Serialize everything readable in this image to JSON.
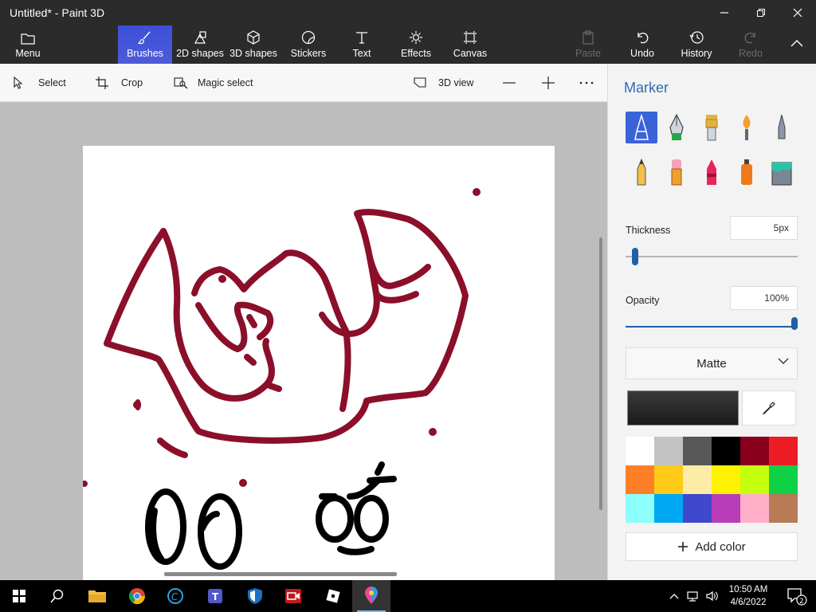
{
  "window": {
    "title": "Untitled* - Paint 3D"
  },
  "ribbon": {
    "menu_label": "Menu",
    "tabs": [
      {
        "label": "Brushes",
        "icon": "brush-icon"
      },
      {
        "label": "2D shapes",
        "icon": "2d-shapes-icon"
      },
      {
        "label": "3D shapes",
        "icon": "3d-shapes-icon"
      },
      {
        "label": "Stickers",
        "icon": "stickers-icon"
      },
      {
        "label": "Text",
        "icon": "text-icon"
      },
      {
        "label": "Effects",
        "icon": "effects-icon"
      },
      {
        "label": "Canvas",
        "icon": "canvas-icon"
      }
    ],
    "actions": [
      {
        "label": "Paste",
        "icon": "paste-icon",
        "enabled": false
      },
      {
        "label": "Undo",
        "icon": "undo-icon",
        "enabled": true
      },
      {
        "label": "History",
        "icon": "history-icon",
        "enabled": true
      },
      {
        "label": "Redo",
        "icon": "redo-icon",
        "enabled": false
      }
    ]
  },
  "toolbar": {
    "select_label": "Select",
    "crop_label": "Crop",
    "magic_select_label": "Magic select",
    "view3d_label": "3D view"
  },
  "panel": {
    "title": "Marker",
    "thickness_label": "Thickness",
    "thickness_value": "5px",
    "thickness_fraction": 0.05,
    "opacity_label": "Opacity",
    "opacity_value": "100%",
    "opacity_fraction": 1.0,
    "finish_label": "Matte",
    "current_color": "#1a1a1a",
    "add_color_label": "Add color",
    "brushes": [
      "marker",
      "calligraphy-pen",
      "oil-brush",
      "watercolor",
      "pixel-pen",
      "pencil",
      "eraser",
      "crayon",
      "spray-can",
      "fill"
    ],
    "swatches": [
      "#ffffff",
      "#c3c3c3",
      "#585858",
      "#000000",
      "#88001b",
      "#ec1c24",
      "#ff7f27",
      "#ffca18",
      "#fdeca6",
      "#fff200",
      "#c4ff0e",
      "#0ed145",
      "#8cfffb",
      "#00a8f3",
      "#3f48cc",
      "#b83dba",
      "#ffaec8",
      "#b97a56"
    ]
  },
  "taskbar": {
    "apps": [
      "windows-start-icon",
      "search-icon",
      "file-explorer-icon",
      "chrome-icon",
      "cortana-icon",
      "teams-icon",
      "defender-icon",
      "camera-app-icon",
      "roblox-icon",
      "paint3d-icon"
    ],
    "time": "10:50 AM",
    "date": "4/6/2022",
    "notifications": "2"
  }
}
